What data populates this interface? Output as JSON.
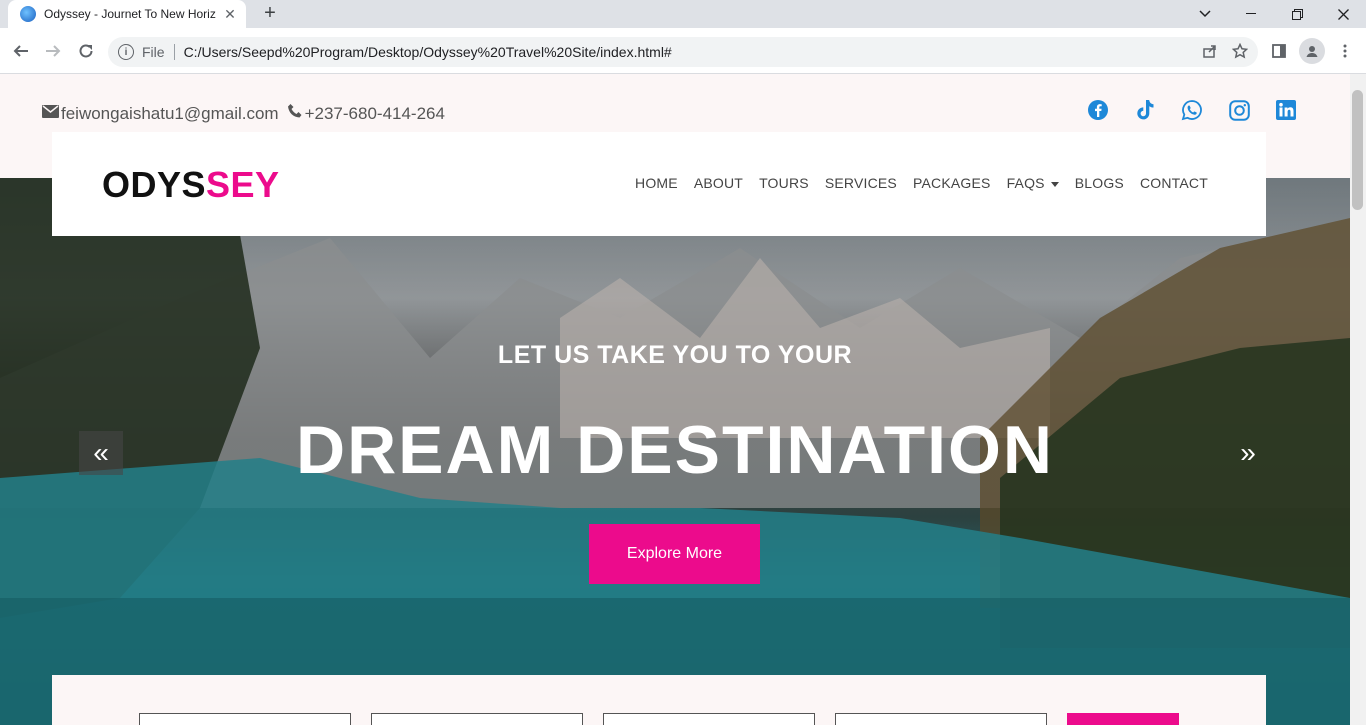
{
  "browser": {
    "tab_title": "Odyssey - Journet To New Horizons",
    "tab_close": "✕",
    "new_tab": "+",
    "scheme": "File",
    "url": "C:/Users/Seepd%20Program/Desktop/Odyssey%20Travel%20Site/index.html#"
  },
  "contact": {
    "email": "feiwongaishatu1@gmail.com",
    "phone": "+237-680-414-264"
  },
  "socials": [
    "facebook-icon",
    "tiktok-icon",
    "whatsapp-icon",
    "instagram-icon",
    "linkedin-icon"
  ],
  "brand": {
    "logo_part1": "ODYS",
    "logo_part2": "SEY",
    "accent_color": "#ec0b8c",
    "social_color": "#1e88d8"
  },
  "nav": {
    "items": [
      "HOME",
      "ABOUT",
      "TOURS",
      "SERVICES",
      "PACKAGES",
      "FAQS",
      "BLOGS",
      "CONTACT"
    ]
  },
  "hero": {
    "subtitle": "LET US TAKE YOU TO YOUR",
    "title": "DREAM DESTINATION",
    "button": "Explore More",
    "prev": "«",
    "next": "»"
  }
}
